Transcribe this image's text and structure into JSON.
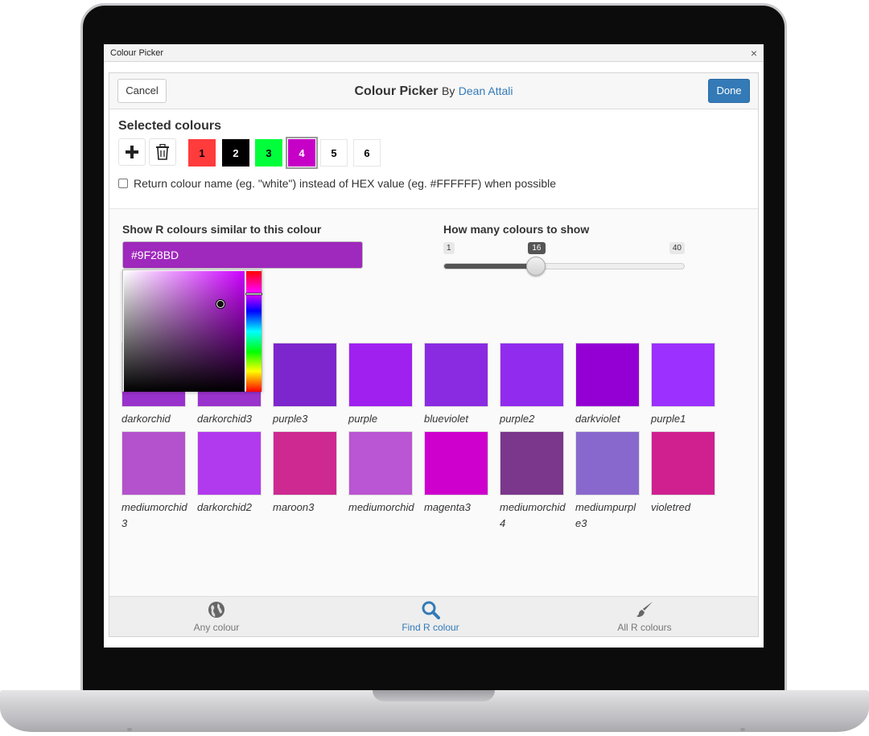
{
  "window": {
    "title": "Colour Picker",
    "close_icon": "×"
  },
  "header": {
    "cancel_label": "Cancel",
    "title": "Colour Picker",
    "by": "By",
    "author": "Dean Attali",
    "done_label": "Done"
  },
  "selected": {
    "title": "Selected colours",
    "swatches": [
      {
        "label": "1",
        "color": "#ff3b3b",
        "text_color": "#000000"
      },
      {
        "label": "2",
        "color": "#000000",
        "text_color": "#ffffff"
      },
      {
        "label": "3",
        "color": "#00ff3a",
        "text_color": "#000000"
      },
      {
        "label": "4",
        "color": "#c600c6",
        "text_color": "#ffffff",
        "selected": true
      },
      {
        "label": "5",
        "color": "#ffffff",
        "text_color": "#000000"
      },
      {
        "label": "6",
        "color": "#ffffff",
        "text_color": "#000000"
      }
    ],
    "return_name_text": "Return colour name (eg. \"white\") instead of HEX value (eg. #FFFFFF) when possible",
    "return_name_checked": false
  },
  "similar": {
    "label": "Show R colours similar to this colour",
    "value": "#9F28BD",
    "input_color": "#9f28bd"
  },
  "count": {
    "label": "How many colours to show",
    "min": "1",
    "max": "40",
    "value": "16",
    "value_num": 16
  },
  "results": [
    {
      "name": "darkorchid",
      "color": "#9932cc"
    },
    {
      "name": "darkorchid3",
      "color": "#9a32cd"
    },
    {
      "name": "purple3",
      "color": "#7d26cd"
    },
    {
      "name": "purple",
      "color": "#a020f0"
    },
    {
      "name": "blueviolet",
      "color": "#8a2be2"
    },
    {
      "name": "purple2",
      "color": "#912cee"
    },
    {
      "name": "darkviolet",
      "color": "#9400d3"
    },
    {
      "name": "purple1",
      "color": "#9b30ff"
    },
    {
      "name": "mediumorchid3",
      "color": "#b452cd"
    },
    {
      "name": "darkorchid2",
      "color": "#b23aee"
    },
    {
      "name": "maroon3",
      "color": "#cd2990"
    },
    {
      "name": "mediumorchid",
      "color": "#ba55d3"
    },
    {
      "name": "magenta3",
      "color": "#cd00cd"
    },
    {
      "name": "mediumorchid4",
      "color": "#7a378b"
    },
    {
      "name": "mediumpurple3",
      "color": "#8968cd"
    },
    {
      "name": "violetred",
      "color": "#d02090"
    }
  ],
  "footer": {
    "tabs": [
      {
        "label": "Any colour",
        "icon": "globe-icon",
        "active": false
      },
      {
        "label": "Find R colour",
        "icon": "search-icon",
        "active": true
      },
      {
        "label": "All R colours",
        "icon": "paintbrush-icon",
        "active": false
      }
    ]
  },
  "colors": {
    "accent": "#337ab7"
  }
}
